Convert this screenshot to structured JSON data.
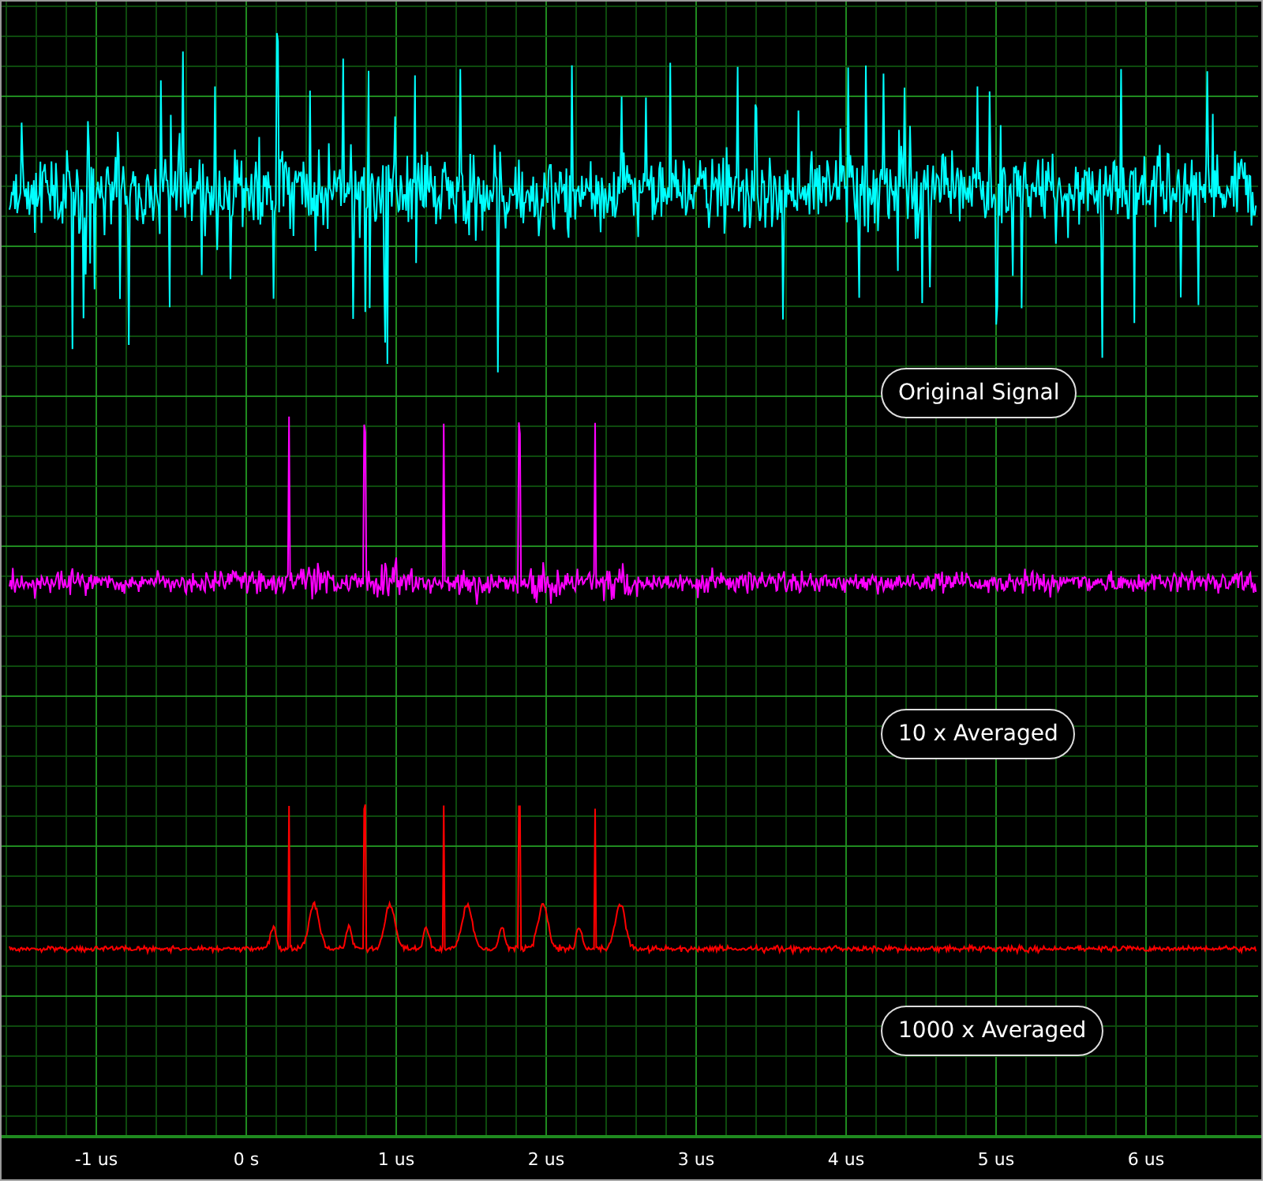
{
  "traces": [
    {
      "label": "Original Signal",
      "color": "#00ffff"
    },
    {
      "label": "10 x Averaged",
      "color": "#ff00ff"
    },
    {
      "label": "1000 x Averaged",
      "color": "#ff0000"
    }
  ],
  "x_axis": {
    "labels": [
      "-1 us",
      "0 s",
      "1 us",
      "2 us",
      "3 us",
      "4 us",
      "5 us",
      "6 us"
    ]
  }
}
